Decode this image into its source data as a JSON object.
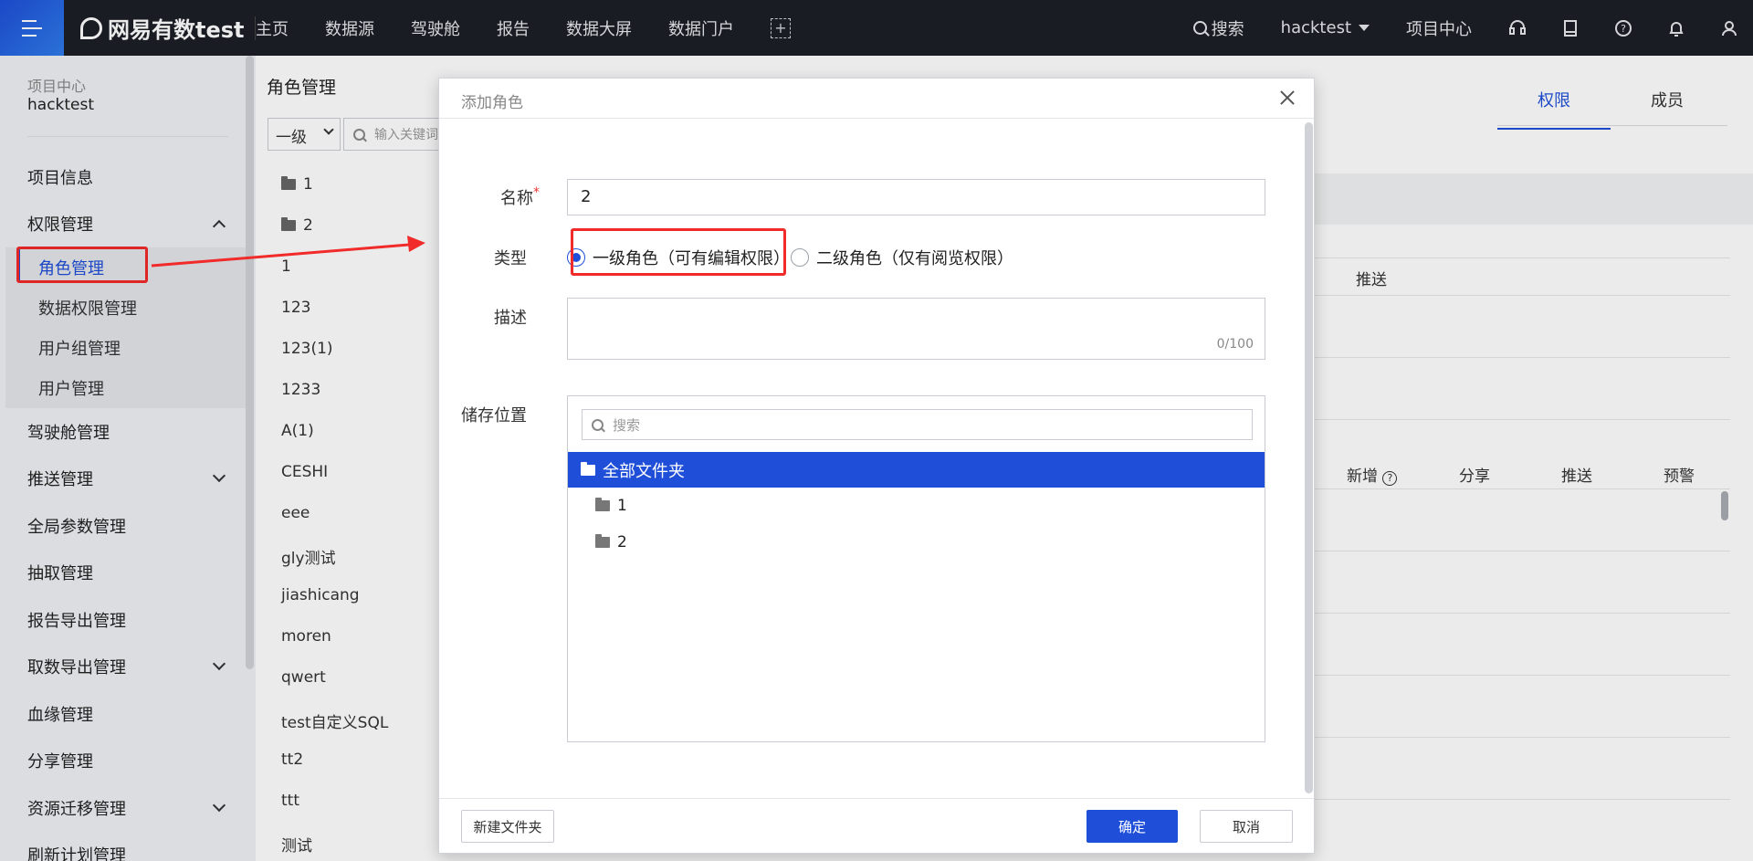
{
  "topbar": {
    "logo_text": "网易有数test",
    "nav": [
      "主页",
      "数据源",
      "驾驶舱",
      "报告",
      "数据大屏",
      "数据门户"
    ],
    "add_label": "+",
    "search_label": "搜索",
    "user": "hacktest",
    "project_center": "项目中心",
    "icons": [
      "headset-icon",
      "book-icon",
      "help-icon",
      "bell-icon",
      "user-icon"
    ]
  },
  "sidebar": {
    "project_label": "项目中心",
    "project_name": "hacktest",
    "items": {
      "project_info": "项目信息",
      "permission": "权限管理",
      "role": "角色管理",
      "data_perm": "数据权限管理",
      "user_group": "用户组管理",
      "user": "用户管理",
      "cockpit": "驾驶舱管理",
      "push": "推送管理",
      "global_param": "全局参数管理",
      "extract": "抽取管理",
      "report_export": "报告导出管理",
      "data_export": "取数导出管理",
      "lineage": "血缘管理",
      "share": "分享管理",
      "migration": "资源迁移管理",
      "refresh": "刷新计划管理"
    }
  },
  "role_panel": {
    "title": "角色管理",
    "level_value": "一级",
    "search_placeholder": "输入关键词",
    "folders": [
      "1",
      "2"
    ],
    "roles": [
      "1",
      "123",
      "123(1)",
      "1233",
      "A(1)",
      "CESHI",
      "eee",
      "gly测试",
      "jiashicang",
      "moren",
      "qwert",
      "test自定义SQL",
      "tt2",
      "ttt",
      "测试"
    ]
  },
  "background": {
    "tabs": [
      "权限",
      "成员"
    ],
    "col_push": "推送",
    "cols2": [
      "新增",
      "分享",
      "推送",
      "预警"
    ]
  },
  "dialog": {
    "title": "添加角色",
    "name_label": "名称",
    "name_value": "2",
    "type_label": "类型",
    "type_options": [
      "一级角色（可有编辑权限）",
      "二级角色（仅有阅览权限）"
    ],
    "selected_type": 0,
    "desc_label": "描述",
    "desc_count": "0/100",
    "storage_label": "储存位置",
    "storage_search_placeholder": "搜索",
    "tree_root": "全部文件夹",
    "tree_children": [
      "1",
      "2"
    ],
    "new_folder": "新建文件夹",
    "confirm": "确定",
    "cancel": "取消"
  },
  "colors": {
    "accent": "#1f4fd8",
    "annotation": "#f12a2a",
    "topbar": "#1c1f26"
  }
}
